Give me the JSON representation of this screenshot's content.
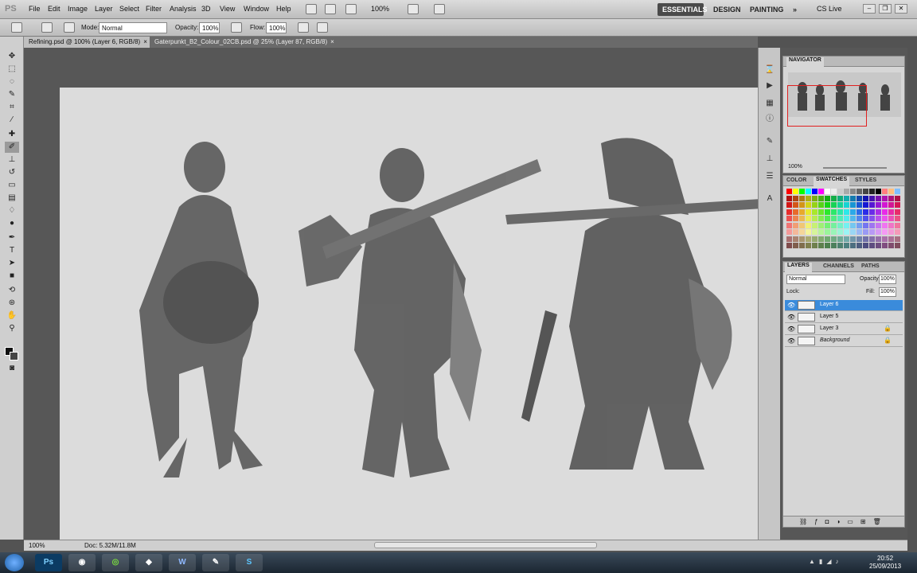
{
  "app": {
    "logo": "PS"
  },
  "menu": [
    "File",
    "Edit",
    "Image",
    "Layer",
    "Select",
    "Filter",
    "Analysis",
    "3D",
    "View",
    "Window",
    "Help"
  ],
  "zoom_menu": "100%",
  "workspaces": {
    "essentials": "ESSENTIALS",
    "design": "DESIGN",
    "painting": "PAINTING",
    "more": "»"
  },
  "cs_live": "CS Live",
  "options": {
    "mode_label": "Mode:",
    "mode_value": "Normal",
    "opacity_label": "Opacity:",
    "opacity_value": "100%",
    "flow_label": "Flow:",
    "flow_value": "100%"
  },
  "tabs": {
    "active": "Refining.psd @ 100% (Layer 6, RGB/8)",
    "inactive": "Gaterpunkt_B2_Colour_02CB.psd @ 25% (Layer 87, RGB/8)",
    "close": "×"
  },
  "status": {
    "zoom": "100%",
    "doc": "Doc: 5.32M/11.8M"
  },
  "panels": {
    "navigator": {
      "title": "NAVIGATOR",
      "zoom": "100%"
    },
    "color_tabs": [
      "COLOR",
      "SWATCHES",
      "STYLES"
    ],
    "layers_tabs": [
      "LAYERS",
      "CHANNELS",
      "PATHS"
    ],
    "layers": {
      "blend_mode": "Normal",
      "opacity_label": "Opacity:",
      "opacity_value": "100%",
      "lock_label": "Lock:",
      "fill_label": "Fill:",
      "fill_value": "100%",
      "items": [
        {
          "name": "Layer 6",
          "selected": true,
          "locked": false
        },
        {
          "name": "Layer 5",
          "selected": false,
          "locked": false
        },
        {
          "name": "Layer 3",
          "selected": false,
          "locked": true
        },
        {
          "name": "Background",
          "selected": false,
          "locked": true
        }
      ]
    }
  },
  "taskbar": {
    "apps": [
      "Ps",
      "Chrome",
      "Spotify",
      "App",
      "Word",
      "Paint",
      "Skype"
    ],
    "time": "20:52",
    "date": "25/09/2013"
  },
  "colors": {
    "selection_blue": "#3a8bdb",
    "nav_box_red": "#e02020",
    "canvas_bg": "#dcdcdc"
  }
}
